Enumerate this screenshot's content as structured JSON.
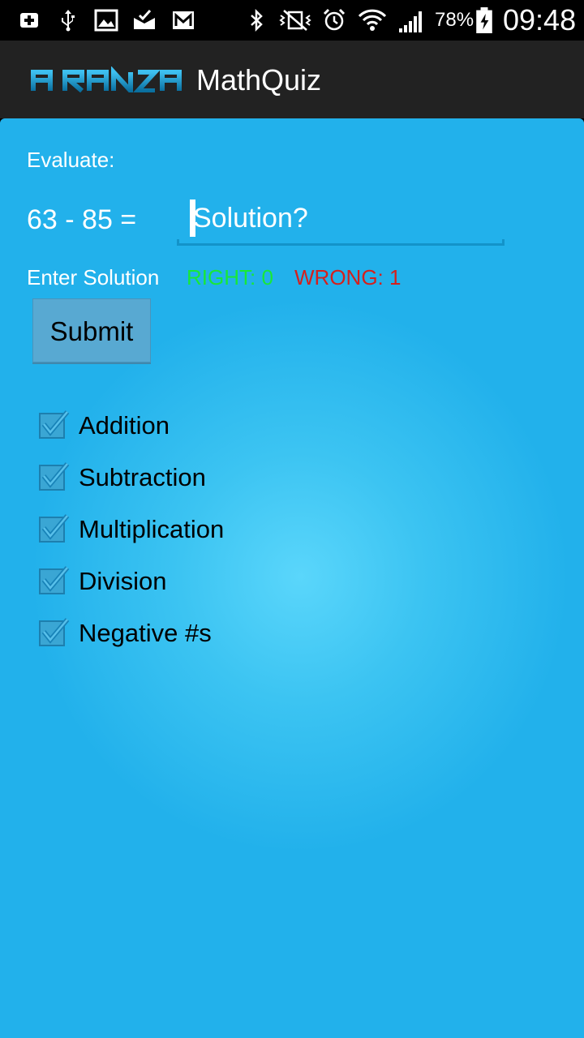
{
  "status_bar": {
    "battery_percent": "78%",
    "time": "09:48"
  },
  "action_bar": {
    "logo_text": "AIRANZA",
    "title": "MathQuiz"
  },
  "quiz": {
    "evaluate_label": "Evaluate:",
    "equation": "63 - 85 =",
    "solution_placeholder": "Solution?",
    "enter_label": "Enter Solution",
    "right_label": "RIGHT: 0",
    "wrong_label": "WRONG: 1",
    "submit_label": "Submit"
  },
  "options": [
    {
      "label": "Addition",
      "checked": true
    },
    {
      "label": "Subtraction",
      "checked": true
    },
    {
      "label": "Multiplication",
      "checked": true
    },
    {
      "label": "Division",
      "checked": true
    },
    {
      "label": "Negative #s",
      "checked": true
    }
  ],
  "colors": {
    "accent": "#22b1eb",
    "right": "#18e838",
    "wrong": "#d5201d"
  }
}
